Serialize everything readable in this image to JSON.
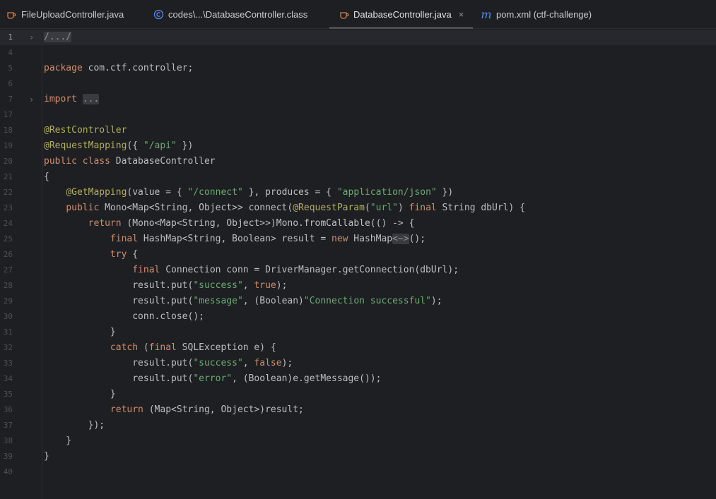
{
  "tabs": [
    {
      "label": "FileUploadController.java",
      "icon": "java-file-icon",
      "active": false
    },
    {
      "label": "codes\\...\\DatabaseController.class",
      "icon": "class-file-icon",
      "active": false
    },
    {
      "label": "DatabaseController.java",
      "icon": "java-file-icon",
      "active": true,
      "close": "×"
    },
    {
      "label": "pom.xml (ctf-challenge)",
      "icon": "maven-icon",
      "active": false
    }
  ],
  "colors": {
    "background": "#1e1f22",
    "keyword": "#cf8e6d",
    "string": "#6aab73",
    "annotation": "#b3ae60",
    "text": "#bcbec4"
  },
  "editor": {
    "current_line": "1",
    "lines": [
      {
        "n": "1",
        "fold": "›",
        "tokens": [
          {
            "t": "/.../",
            "c": "folded"
          }
        ]
      },
      {
        "n": "4",
        "tokens": []
      },
      {
        "n": "5",
        "tokens": [
          {
            "t": "package",
            "c": "kw"
          },
          {
            "t": " com.ctf.controller;",
            "c": "plain"
          }
        ]
      },
      {
        "n": "6",
        "tokens": []
      },
      {
        "n": "7",
        "fold": "›",
        "tokens": [
          {
            "t": "import",
            "c": "kw"
          },
          {
            "t": " ",
            "c": "plain"
          },
          {
            "t": "...",
            "c": "folded"
          }
        ]
      },
      {
        "n": "17",
        "tokens": []
      },
      {
        "n": "18",
        "tokens": [
          {
            "t": "@RestController",
            "c": "ann"
          }
        ]
      },
      {
        "n": "19",
        "tokens": [
          {
            "t": "@RequestMapping",
            "c": "ann"
          },
          {
            "t": "({ ",
            "c": "plain"
          },
          {
            "t": "\"/api\"",
            "c": "str"
          },
          {
            "t": " })",
            "c": "plain"
          }
        ]
      },
      {
        "n": "20",
        "tokens": [
          {
            "t": "public class",
            "c": "kw"
          },
          {
            "t": " DatabaseController",
            "c": "plain"
          }
        ]
      },
      {
        "n": "21",
        "tokens": [
          {
            "t": "{",
            "c": "plain"
          }
        ]
      },
      {
        "n": "22",
        "tokens": [
          {
            "t": "    ",
            "c": "plain"
          },
          {
            "t": "@GetMapping",
            "c": "ann"
          },
          {
            "t": "(value = { ",
            "c": "plain"
          },
          {
            "t": "\"/connect\"",
            "c": "str"
          },
          {
            "t": " }, produces = { ",
            "c": "plain"
          },
          {
            "t": "\"application/json\"",
            "c": "str"
          },
          {
            "t": " })",
            "c": "plain"
          }
        ]
      },
      {
        "n": "23",
        "tokens": [
          {
            "t": "    ",
            "c": "plain"
          },
          {
            "t": "public",
            "c": "kw"
          },
          {
            "t": " Mono<Map<String, Object>> connect(",
            "c": "plain"
          },
          {
            "t": "@RequestParam",
            "c": "ann"
          },
          {
            "t": "(",
            "c": "plain"
          },
          {
            "t": "\"url\"",
            "c": "str"
          },
          {
            "t": ") ",
            "c": "plain"
          },
          {
            "t": "final",
            "c": "kw"
          },
          {
            "t": " String dbUrl) {",
            "c": "plain"
          }
        ]
      },
      {
        "n": "24",
        "tokens": [
          {
            "t": "        ",
            "c": "plain"
          },
          {
            "t": "return",
            "c": "kw"
          },
          {
            "t": " (Mono<Map<String, Object>>)Mono.fromCallable(() -> {",
            "c": "plain"
          }
        ]
      },
      {
        "n": "25",
        "tokens": [
          {
            "t": "            ",
            "c": "plain"
          },
          {
            "t": "final",
            "c": "kw"
          },
          {
            "t": " HashMap<String, Boolean> result = ",
            "c": "plain"
          },
          {
            "t": "new",
            "c": "kw"
          },
          {
            "t": " HashMap",
            "c": "plain"
          },
          {
            "t": "<~>",
            "c": "folded"
          },
          {
            "t": "();",
            "c": "plain"
          }
        ]
      },
      {
        "n": "26",
        "tokens": [
          {
            "t": "            ",
            "c": "plain"
          },
          {
            "t": "try",
            "c": "kw"
          },
          {
            "t": " {",
            "c": "plain"
          }
        ]
      },
      {
        "n": "27",
        "tokens": [
          {
            "t": "                ",
            "c": "plain"
          },
          {
            "t": "final",
            "c": "kw"
          },
          {
            "t": " Connection conn = DriverManager.getConnection(dbUrl);",
            "c": "plain"
          }
        ]
      },
      {
        "n": "28",
        "tokens": [
          {
            "t": "                result.put(",
            "c": "plain"
          },
          {
            "t": "\"success\"",
            "c": "str"
          },
          {
            "t": ", ",
            "c": "plain"
          },
          {
            "t": "true",
            "c": "kw"
          },
          {
            "t": ");",
            "c": "plain"
          }
        ]
      },
      {
        "n": "29",
        "tokens": [
          {
            "t": "                result.put(",
            "c": "plain"
          },
          {
            "t": "\"message\"",
            "c": "str"
          },
          {
            "t": ", (Boolean)",
            "c": "plain"
          },
          {
            "t": "\"Connection successful\"",
            "c": "str"
          },
          {
            "t": ");",
            "c": "plain"
          }
        ]
      },
      {
        "n": "30",
        "tokens": [
          {
            "t": "                conn.close();",
            "c": "plain"
          }
        ]
      },
      {
        "n": "31",
        "tokens": [
          {
            "t": "            }",
            "c": "plain"
          }
        ]
      },
      {
        "n": "32",
        "tokens": [
          {
            "t": "            ",
            "c": "plain"
          },
          {
            "t": "catch",
            "c": "kw"
          },
          {
            "t": " (",
            "c": "plain"
          },
          {
            "t": "final",
            "c": "kw"
          },
          {
            "t": " SQLException e) {",
            "c": "plain"
          }
        ]
      },
      {
        "n": "33",
        "tokens": [
          {
            "t": "                result.put(",
            "c": "plain"
          },
          {
            "t": "\"success\"",
            "c": "str"
          },
          {
            "t": ", ",
            "c": "plain"
          },
          {
            "t": "false",
            "c": "kw"
          },
          {
            "t": ");",
            "c": "plain"
          }
        ]
      },
      {
        "n": "34",
        "tokens": [
          {
            "t": "                result.put(",
            "c": "plain"
          },
          {
            "t": "\"error\"",
            "c": "str"
          },
          {
            "t": ", (Boolean)e.getMessage());",
            "c": "plain"
          }
        ]
      },
      {
        "n": "35",
        "tokens": [
          {
            "t": "            }",
            "c": "plain"
          }
        ]
      },
      {
        "n": "36",
        "tokens": [
          {
            "t": "            ",
            "c": "plain"
          },
          {
            "t": "return",
            "c": "kw"
          },
          {
            "t": " (Map<String, Object>)result;",
            "c": "plain"
          }
        ]
      },
      {
        "n": "37",
        "tokens": [
          {
            "t": "        });",
            "c": "plain"
          }
        ]
      },
      {
        "n": "38",
        "tokens": [
          {
            "t": "    }",
            "c": "plain"
          }
        ]
      },
      {
        "n": "39",
        "tokens": [
          {
            "t": "}",
            "c": "plain"
          }
        ]
      },
      {
        "n": "40",
        "tokens": []
      }
    ]
  }
}
